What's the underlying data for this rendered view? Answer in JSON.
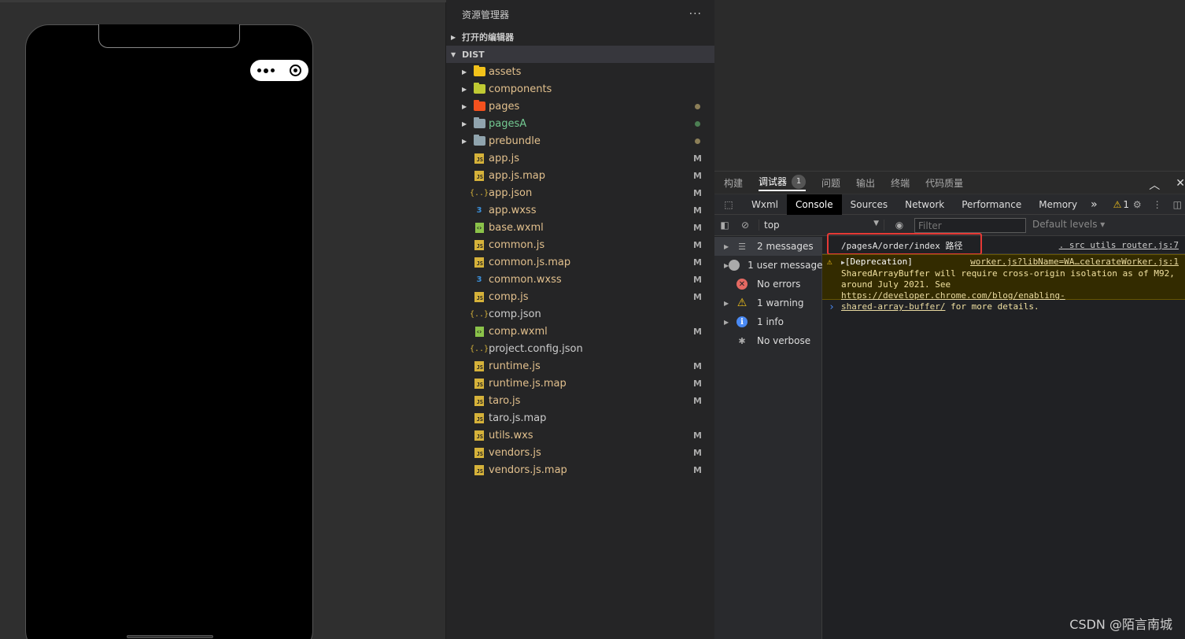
{
  "explorer": {
    "title": "资源管理器",
    "more": "···",
    "open_editors": "打开的编辑器",
    "root": "DIST",
    "items": [
      {
        "name": "assets",
        "type": "folder",
        "icon": "folder-assets-icon",
        "color": "#f2c21a",
        "marker": ""
      },
      {
        "name": "components",
        "type": "folder",
        "icon": "folder-components-icon",
        "color": "#c0ca33",
        "marker": ""
      },
      {
        "name": "pages",
        "type": "folder",
        "icon": "folder-pages-icon",
        "color": "#f4511e",
        "marker": "dot",
        "dot_color": "#8c7f58"
      },
      {
        "name": "pagesA",
        "type": "folder",
        "icon": "folder-icon",
        "color": "#90a4ae",
        "marker": "dot",
        "dot_color": "#4c7f53",
        "name_color": "#73c991"
      },
      {
        "name": "prebundle",
        "type": "folder",
        "icon": "folder-icon",
        "color": "#90a4ae",
        "marker": "dot",
        "dot_color": "#8c7f58"
      },
      {
        "name": "app.js",
        "type": "js",
        "icon": "js-file-icon",
        "marker": "M"
      },
      {
        "name": "app.js.map",
        "type": "js",
        "icon": "js-file-icon",
        "marker": "M"
      },
      {
        "name": "app.json",
        "type": "json",
        "icon": "json-file-icon",
        "marker": "M"
      },
      {
        "name": "app.wxss",
        "type": "css",
        "icon": "css-file-icon",
        "marker": "M"
      },
      {
        "name": "base.wxml",
        "type": "wxml",
        "icon": "wxml-file-icon",
        "marker": "M"
      },
      {
        "name": "common.js",
        "type": "js",
        "icon": "js-file-icon",
        "marker": "M"
      },
      {
        "name": "common.js.map",
        "type": "js",
        "icon": "js-file-icon",
        "marker": "M"
      },
      {
        "name": "common.wxss",
        "type": "css",
        "icon": "css-file-icon",
        "marker": "M"
      },
      {
        "name": "comp.js",
        "type": "js",
        "icon": "js-file-icon",
        "marker": "M"
      },
      {
        "name": "comp.json",
        "type": "json",
        "icon": "json-file-icon",
        "marker": "",
        "name_color": "#cccccc"
      },
      {
        "name": "comp.wxml",
        "type": "wxml",
        "icon": "wxml-file-icon",
        "marker": "M"
      },
      {
        "name": "project.config.json",
        "type": "json",
        "icon": "json-file-icon",
        "marker": "",
        "name_color": "#cccccc"
      },
      {
        "name": "runtime.js",
        "type": "js",
        "icon": "js-file-icon",
        "marker": "M"
      },
      {
        "name": "runtime.js.map",
        "type": "js",
        "icon": "js-file-icon",
        "marker": "M"
      },
      {
        "name": "taro.js",
        "type": "js",
        "icon": "js-file-icon",
        "marker": "M"
      },
      {
        "name": "taro.js.map",
        "type": "js",
        "icon": "js-file-icon",
        "marker": "",
        "name_color": "#cccccc"
      },
      {
        "name": "utils.wxs",
        "type": "js",
        "icon": "js-file-icon",
        "marker": "M"
      },
      {
        "name": "vendors.js",
        "type": "js",
        "icon": "js-file-icon",
        "marker": "M"
      },
      {
        "name": "vendors.js.map",
        "type": "js",
        "icon": "js-file-icon",
        "marker": "M"
      }
    ]
  },
  "devtools": {
    "top_tabs": [
      {
        "label": "构建",
        "active": false
      },
      {
        "label": "调试器",
        "active": true,
        "badge": "1"
      },
      {
        "label": "问题",
        "active": false
      },
      {
        "label": "输出",
        "active": false
      },
      {
        "label": "终端",
        "active": false
      },
      {
        "label": "代码质量",
        "active": false
      }
    ],
    "panel_tabs": [
      {
        "label": "Wxml",
        "active": false
      },
      {
        "label": "Console",
        "active": true
      },
      {
        "label": "Sources",
        "active": false
      },
      {
        "label": "Network",
        "active": false
      },
      {
        "label": "Performance",
        "active": false
      },
      {
        "label": "Memory",
        "active": false
      }
    ],
    "overflow": "»",
    "warning_count": "1",
    "context": "top",
    "filter_placeholder": "Filter",
    "levels": "Default levels",
    "sidebar": [
      {
        "label": "2 messages",
        "icon": "list-icon",
        "active": true,
        "caret": true
      },
      {
        "label": "1 user message",
        "icon": "user-icon",
        "active": false,
        "caret": true
      },
      {
        "label": "No errors",
        "icon": "error-icon",
        "active": false,
        "caret": false
      },
      {
        "label": "1 warning",
        "icon": "warning-icon",
        "active": false,
        "caret": true
      },
      {
        "label": "1 info",
        "icon": "info-icon",
        "active": false,
        "caret": true
      },
      {
        "label": "No verbose",
        "icon": "bug-icon",
        "active": false,
        "caret": false
      }
    ],
    "console": {
      "log": {
        "text": "/pagesA/order/index 路径",
        "source": ". src utils router.js:7"
      },
      "warning": {
        "head": "[Deprecation]",
        "source": "worker.js?libName=WA…celerateWorker.js:1",
        "line1": "SharedArrayBuffer will require cross-origin isolation as of M92,",
        "line2_prefix": "around July 2021. See ",
        "link1": "https://developer.chrome.com/blog/enabling-",
        "link2": "shared-array-buffer/",
        "line3_suffix": " for more details."
      },
      "prompt": "›"
    }
  },
  "watermark": "CSDN @陌言南城"
}
